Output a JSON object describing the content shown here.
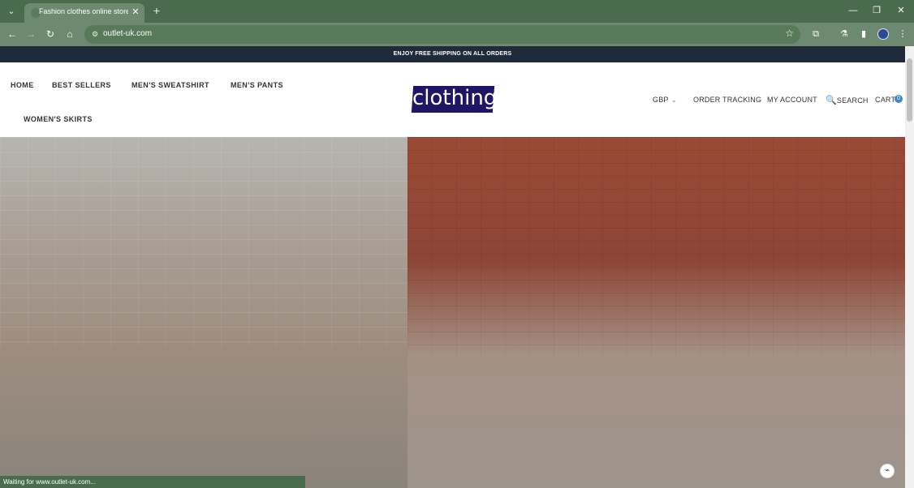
{
  "browser": {
    "tab_title": "Fashion clothes online store, the",
    "url": "outlet-uk.com",
    "status_text": "Waiting for www.outlet-uk.com..."
  },
  "icons": {
    "tab_list": "chevron-down-icon",
    "tab_close": "close-icon",
    "new_tab": "plus-icon",
    "minimize": "minimize-icon",
    "restore": "restore-icon",
    "close_window": "close-icon",
    "back": "back-arrow-icon",
    "forward": "forward-arrow-icon",
    "reload": "reload-icon",
    "home": "home-icon",
    "site_info": "site-info-icon",
    "star": "star-icon",
    "extensions": "puzzle-icon",
    "profile": "avatar",
    "search": "search-icon"
  },
  "site": {
    "promo": "ENJOY FREE SHIPPING ON ALL ORDERS",
    "logo": "clothing",
    "nav": {
      "home": "HOME",
      "best_sellers": "BEST SELLERS",
      "mens_sweatshirt": "MEN'S SWEATSHIRT",
      "mens_pants": "MEN'S PANTS",
      "womens_skirts": "WOMEN'S SKIRTS"
    },
    "right": {
      "currency": "GBP",
      "order_tracking": "ORDER TRACKING",
      "my_account": "MY ACCOUNT",
      "search": "SEARCH",
      "cart": "CART",
      "cart_count": "0"
    }
  },
  "colors": {
    "chrome_dark": "#4a6b4e",
    "chrome_light": "#6d8a70",
    "promo_bg": "#1f2a3b",
    "logo_bg": "#1f1766",
    "cart_badge": "#3f87c7"
  }
}
